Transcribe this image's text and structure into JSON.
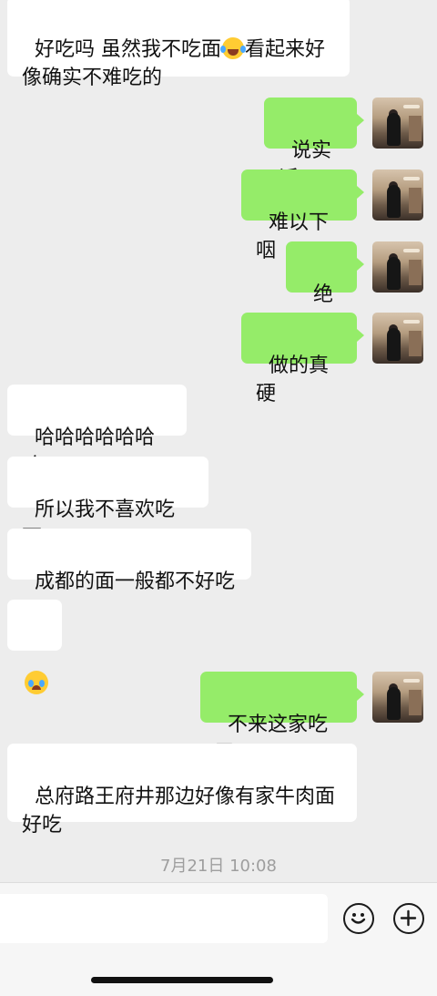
{
  "messages": [
    {
      "dir": "in",
      "text_a": "好吃吗 虽然我不吃面",
      "text_b": "看起来好\n像确实不难吃的",
      "emoji": "laughing-tears"
    },
    {
      "dir": "out",
      "text": "说实话"
    },
    {
      "dir": "out",
      "text": "难以下咽"
    },
    {
      "dir": "out",
      "text": "绝了"
    },
    {
      "dir": "out",
      "text": "做的真硬"
    },
    {
      "dir": "in",
      "text": "哈哈哈哈哈哈哈"
    },
    {
      "dir": "in",
      "text": "所以我不喜欢吃面"
    },
    {
      "dir": "in",
      "text": "成都的面一般都不好吃"
    },
    {
      "dir": "in",
      "emoji": "crying-face"
    },
    {
      "dir": "out",
      "text": "不来这家吃了"
    },
    {
      "dir": "in",
      "text": "总府路王府井那边好像有家牛肉面\n好吃"
    }
  ],
  "timestamp": "7月21日 10:08",
  "input_bar": {
    "emoji_button_icon": "smiley-icon",
    "plus_button_icon": "plus-circle-icon"
  },
  "colors": {
    "background": "#ededed",
    "outgoing_bubble": "#95ec69",
    "incoming_bubble": "#ffffff"
  }
}
